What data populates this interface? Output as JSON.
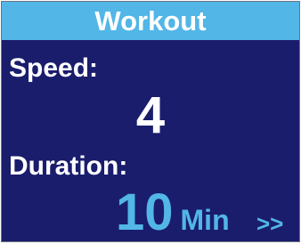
{
  "header": {
    "title": "Workout"
  },
  "speed": {
    "label": "Speed:",
    "value": "4"
  },
  "duration": {
    "label": "Duration:",
    "value": "10",
    "unit": "Min"
  },
  "nav": {
    "next_label": ">>"
  },
  "colors": {
    "background": "#1a1d6c",
    "accent": "#52b6e7",
    "text": "#ffffff"
  }
}
